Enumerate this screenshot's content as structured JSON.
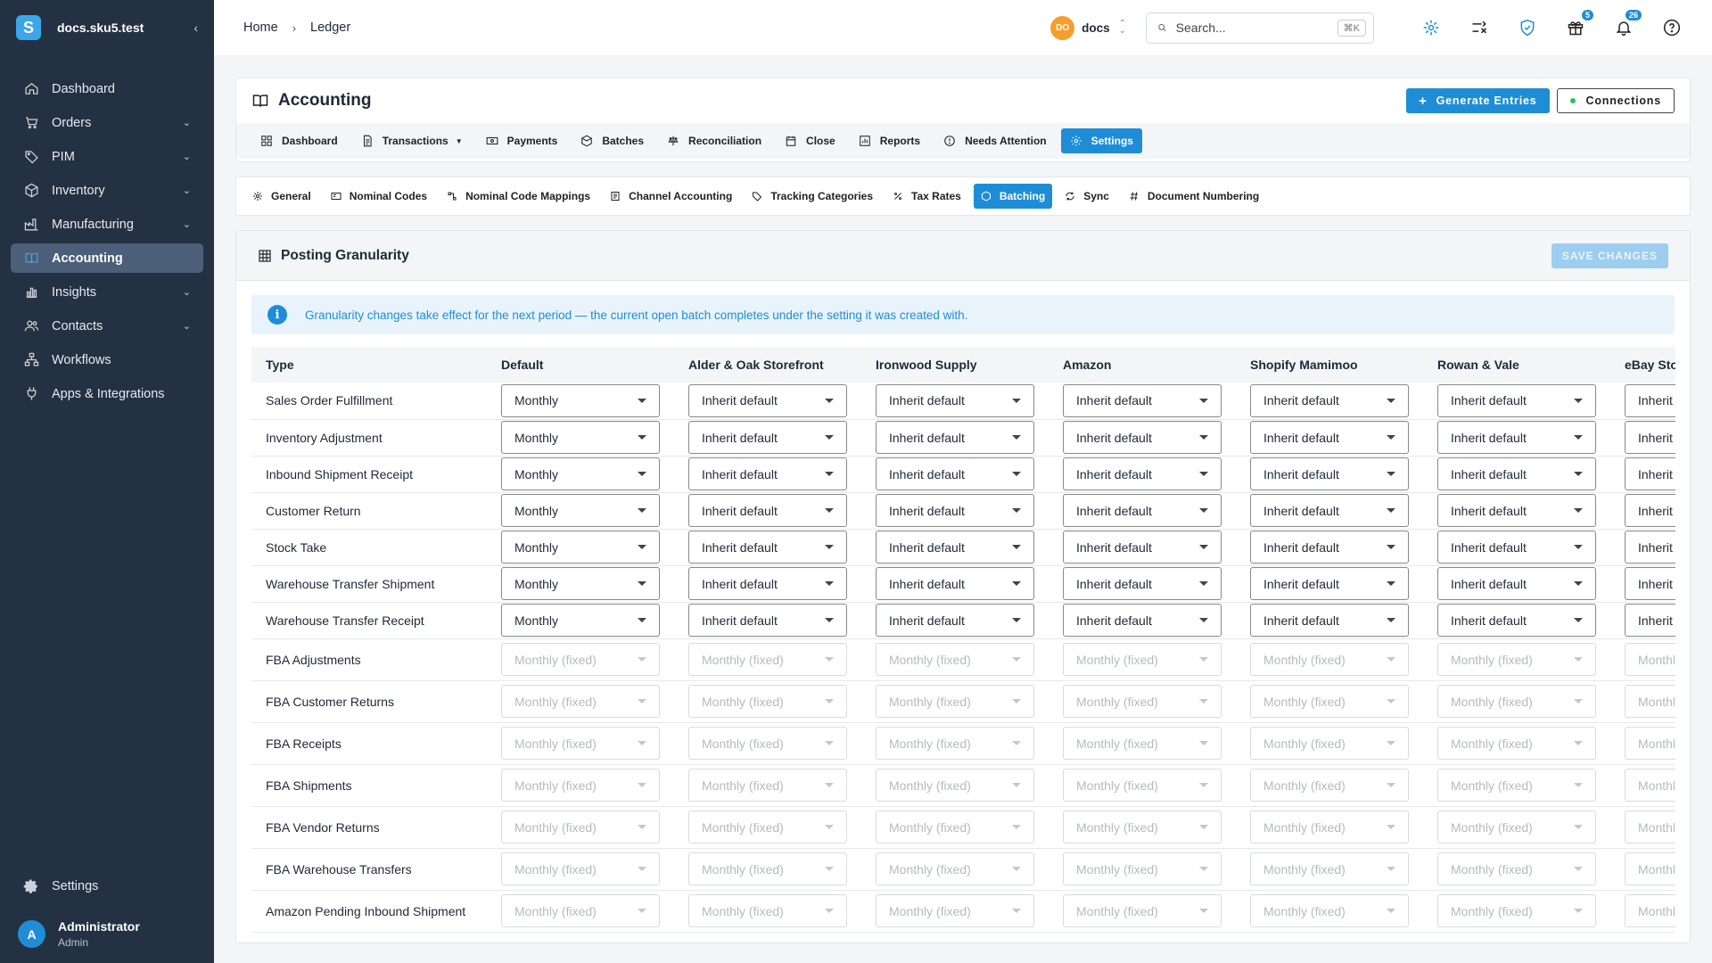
{
  "brand": {
    "name": "docs.sku5.test",
    "logo_letter": "S"
  },
  "sidebar": {
    "items": [
      {
        "label": "Dashboard",
        "icon": "home-icon",
        "expandable": false,
        "active": false
      },
      {
        "label": "Orders",
        "icon": "cart-icon",
        "expandable": true,
        "active": false
      },
      {
        "label": "PIM",
        "icon": "tag-icon",
        "expandable": true,
        "active": false
      },
      {
        "label": "Inventory",
        "icon": "box-icon",
        "expandable": true,
        "active": false
      },
      {
        "label": "Manufacturing",
        "icon": "factory-icon",
        "expandable": true,
        "active": false
      },
      {
        "label": "Accounting",
        "icon": "ledger-icon",
        "expandable": false,
        "active": true
      },
      {
        "label": "Insights",
        "icon": "chart-icon",
        "expandable": true,
        "active": false
      },
      {
        "label": "Contacts",
        "icon": "contacts-icon",
        "expandable": true,
        "active": false
      },
      {
        "label": "Workflows",
        "icon": "workflow-icon",
        "expandable": false,
        "active": false
      },
      {
        "label": "Apps & Integrations",
        "icon": "plug-icon",
        "expandable": false,
        "active": false
      }
    ],
    "settings_label": "Settings",
    "user": {
      "initial": "A",
      "name": "Administrator",
      "role": "Admin"
    }
  },
  "topbar": {
    "breadcrumb": [
      "Home",
      "Ledger"
    ],
    "org": {
      "initials": "DO",
      "name": "docs"
    },
    "search": {
      "placeholder": "Search...",
      "shortcut": "⌘K"
    },
    "gift_badge": "5",
    "notif_badge": "26"
  },
  "header": {
    "title": "Accounting",
    "generate_label": "Generate Entries",
    "connections_label": "Connections",
    "tabs": [
      {
        "label": "Dashboard",
        "active": false,
        "dropdown": false
      },
      {
        "label": "Transactions",
        "active": false,
        "dropdown": true
      },
      {
        "label": "Payments",
        "active": false,
        "dropdown": false
      },
      {
        "label": "Batches",
        "active": false,
        "dropdown": false
      },
      {
        "label": "Reconciliation",
        "active": false,
        "dropdown": false
      },
      {
        "label": "Close",
        "active": false,
        "dropdown": false
      },
      {
        "label": "Reports",
        "active": false,
        "dropdown": false
      },
      {
        "label": "Needs Attention",
        "active": false,
        "dropdown": false
      },
      {
        "label": "Settings",
        "active": true,
        "dropdown": false
      }
    ]
  },
  "settings_tabs": [
    {
      "label": "General",
      "active": false
    },
    {
      "label": "Nominal Codes",
      "active": false
    },
    {
      "label": "Nominal Code Mappings",
      "active": false
    },
    {
      "label": "Channel Accounting",
      "active": false
    },
    {
      "label": "Tracking Categories",
      "active": false
    },
    {
      "label": "Tax Rates",
      "active": false
    },
    {
      "label": "Batching",
      "active": true
    },
    {
      "label": "Sync",
      "active": false
    },
    {
      "label": "Document Numbering",
      "active": false
    }
  ],
  "posting": {
    "title": "Posting Granularity",
    "save_label": "SAVE CHANGES",
    "info": "Granularity changes take effect for the next period — the current open batch completes under the setting it was created with.",
    "columns": [
      "Type",
      "Default",
      "Alder & Oak Storefront",
      "Ironwood Supply",
      "Amazon",
      "Shopify Mamimoo",
      "Rowan & Vale",
      "eBay Stor"
    ],
    "rows": [
      {
        "type": "Sales Order Fulfillment",
        "default": "Monthly",
        "channel_value": "Inherit default",
        "fixed": false
      },
      {
        "type": "Inventory Adjustment",
        "default": "Monthly",
        "channel_value": "Inherit default",
        "fixed": false
      },
      {
        "type": "Inbound Shipment Receipt",
        "default": "Monthly",
        "channel_value": "Inherit default",
        "fixed": false
      },
      {
        "type": "Customer Return",
        "default": "Monthly",
        "channel_value": "Inherit default",
        "fixed": false
      },
      {
        "type": "Stock Take",
        "default": "Monthly",
        "channel_value": "Inherit default",
        "fixed": false
      },
      {
        "type": "Warehouse Transfer Shipment",
        "default": "Monthly",
        "channel_value": "Inherit default",
        "fixed": false
      },
      {
        "type": "Warehouse Transfer Receipt",
        "default": "Monthly",
        "channel_value": "Inherit default",
        "fixed": false
      },
      {
        "type": "FBA Adjustments",
        "default": "Monthly (fixed)",
        "channel_value": "Monthly (fixed)",
        "fixed": true
      },
      {
        "type": "FBA Customer Returns",
        "default": "Monthly (fixed)",
        "channel_value": "Monthly (fixed)",
        "fixed": true
      },
      {
        "type": "FBA Receipts",
        "default": "Monthly (fixed)",
        "channel_value": "Monthly (fixed)",
        "fixed": true
      },
      {
        "type": "FBA Shipments",
        "default": "Monthly (fixed)",
        "channel_value": "Monthly (fixed)",
        "fixed": true
      },
      {
        "type": "FBA Vendor Returns",
        "default": "Monthly (fixed)",
        "channel_value": "Monthly (fixed)",
        "fixed": true
      },
      {
        "type": "FBA Warehouse Transfers",
        "default": "Monthly (fixed)",
        "channel_value": "Monthly (fixed)",
        "fixed": true
      },
      {
        "type": "Amazon Pending Inbound Shipment",
        "default": "Monthly (fixed)",
        "channel_value": "Monthly (fixed)",
        "fixed": true
      }
    ]
  }
}
